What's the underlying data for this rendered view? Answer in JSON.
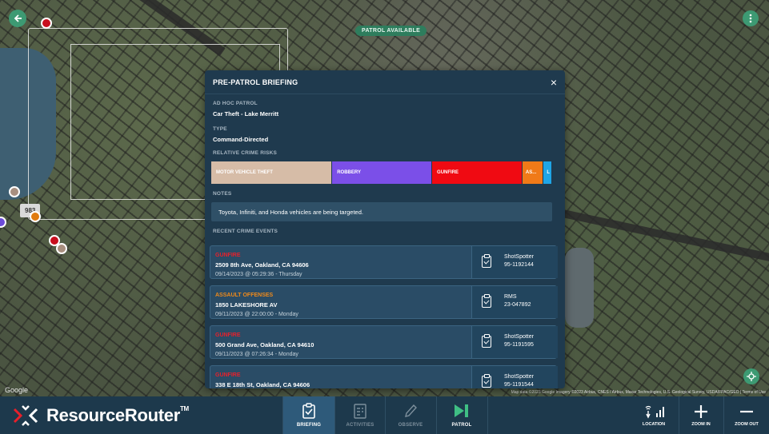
{
  "map": {
    "patrol_badge": "PATROL AVAILABLE",
    "unit_tag": "983",
    "google_label": "Google",
    "attribution": "Map data ©2023 Google Imagery ©2023 Airbus, CNES / Airbus, Maxar Technologies, U.S. Geological Survey, USDA/FPAC/GEO | Terms of Use"
  },
  "modal": {
    "title": "PRE-PATROL BRIEFING",
    "close_glyph": "×",
    "ad_hoc_label": "AD HOC PATROL",
    "ad_hoc_value": "Car Theft - Lake Merritt",
    "type_label": "TYPE",
    "type_value": "Command-Directed",
    "risks_label": "RELATIVE CRIME RISKS",
    "risks": [
      {
        "label": "MOTOR VEHICLE THEFT",
        "share": 0.355,
        "color": "#d6bca7"
      },
      {
        "label": "ROBBERY",
        "share": 0.293,
        "color": "#7b4fe8"
      },
      {
        "label": "GUNFIRE",
        "share": 0.265,
        "color": "#f00a12"
      },
      {
        "label": "AS...",
        "share": 0.062,
        "color": "#f07a18"
      },
      {
        "label": "L",
        "share": 0.025,
        "color": "#1fa5e6"
      }
    ],
    "notes_label": "NOTES",
    "notes_text": "Toyota, Infiniti, and Honda vehicles are being targeted.",
    "events_label": "RECENT CRIME EVENTS",
    "events": [
      {
        "type": "GUNFIRE",
        "type_color": "#e8202b",
        "address": "2509 8th Ave, Oakland, CA 94606",
        "datetime": "09/14/2023 @ 05:29:36 - Thursday",
        "source": "ShotSpotter",
        "source_id": "95-1192144"
      },
      {
        "type": "ASSAULT OFFENSES",
        "type_color": "#f08a1a",
        "address": "1850 LAKESHORE AV",
        "datetime": "09/11/2023 @ 22:00:00 - Monday",
        "source": "RMS",
        "source_id": "23-047892"
      },
      {
        "type": "GUNFIRE",
        "type_color": "#e8202b",
        "address": "500 Grand Ave, Oakland, CA 94610",
        "datetime": "09/11/2023 @ 07:26:34 - Monday",
        "source": "ShotSpotter",
        "source_id": "95-1191595"
      },
      {
        "type": "GUNFIRE",
        "type_color": "#e8202b",
        "address": "338 E 18th St, Oakland, CA 94606",
        "datetime": "",
        "source": "ShotSpotter",
        "source_id": "95-1191544"
      }
    ]
  },
  "bottombar": {
    "brand": "ResourceRouter",
    "brand_tm": "TM",
    "nav": [
      {
        "label": "BRIEFING",
        "state": "active"
      },
      {
        "label": "ACTIVITIES",
        "state": "disabled"
      },
      {
        "label": "OBSERVE",
        "state": "disabled"
      },
      {
        "label": "PATROL",
        "state": "enabled"
      }
    ],
    "location_label": "LOCATION",
    "zoom_in_label": "ZOOM IN",
    "zoom_out_label": "ZOOM OUT"
  },
  "colors": {
    "modal_bg": "#1f3a4e",
    "bar_bg": "#1d394c",
    "accent_green": "#3d9a73"
  }
}
